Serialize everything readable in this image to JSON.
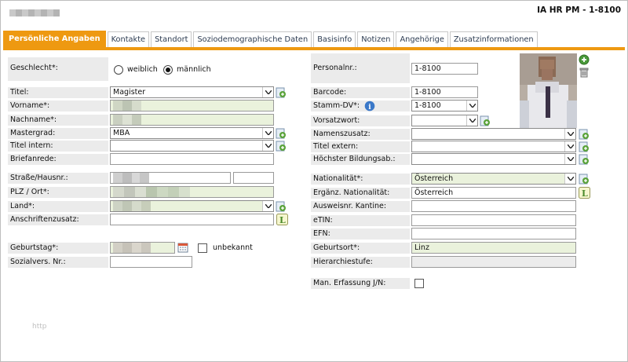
{
  "header": {
    "app_title": "IA HR PM - 1-8100"
  },
  "tabs": [
    "Persönliche Angaben",
    "Kontakte",
    "Standort",
    "Soziodemographische Daten",
    "Basisinfo",
    "Notizen",
    "Angehörige",
    "Zusatzinformationen"
  ],
  "left": {
    "gender": {
      "label": "Geschlecht*:",
      "option_female": "weiblich",
      "option_male": "männlich",
      "selected": "männlich"
    },
    "title": {
      "label": "Titel:",
      "value": "Magister"
    },
    "first_name": {
      "label": "Vorname*:"
    },
    "last_name": {
      "label": "Nachname*:"
    },
    "master_degree": {
      "label": "Mastergrad:",
      "value": "MBA"
    },
    "title_internal": {
      "label": "Titel intern:",
      "value": ""
    },
    "salutation": {
      "label": "Briefanrede:",
      "value": ""
    },
    "street": {
      "label": "Straße/Hausnr.:"
    },
    "zip_city": {
      "label": "PLZ / Ort*:"
    },
    "country": {
      "label": "Land*:"
    },
    "address_extra": {
      "label": "Anschriftenzusatz:",
      "value": ""
    },
    "birthday": {
      "label": "Geburtstag*:",
      "unknown_label": "unbekannt"
    },
    "social_security": {
      "label": "Sozialvers. Nr.:",
      "value": ""
    }
  },
  "right": {
    "personnel_no": {
      "label": "Personalnr.:",
      "value": "1-8100"
    },
    "barcode": {
      "label": "Barcode:",
      "value": "1-8100"
    },
    "master_dv": {
      "label": "Stamm-DV*:",
      "value": "1-8100"
    },
    "prefix": {
      "label": "Vorsatzwort:",
      "value": ""
    },
    "name_suffix": {
      "label": "Namenszusatz:",
      "value": ""
    },
    "title_external": {
      "label": "Titel extern:",
      "value": ""
    },
    "highest_education": {
      "label": "Höchster Bildungsab.:",
      "value": ""
    },
    "nationality": {
      "label": "Nationalität*:",
      "value": "Österreich"
    },
    "add_nationality": {
      "label": "Ergänz. Nationalität:",
      "value": "Österreich"
    },
    "canteen_card": {
      "label": "Ausweisnr. Kantine:",
      "value": ""
    },
    "etin": {
      "label": "eTIN:",
      "value": ""
    },
    "efn": {
      "label": "EFN:",
      "value": ""
    },
    "birthplace": {
      "label": "Geburtsort*:",
      "value": "Linz"
    },
    "hierarchy": {
      "label": "Hierarchiestufe:",
      "value": ""
    },
    "manual_entry": {
      "label": "Man. Erfassung J/N:"
    }
  },
  "footer": {
    "text": "http"
  },
  "colors": {
    "accent": "#ee9911",
    "label_bg": "#ebebeb",
    "mandatory_bg": "#eaf2dc",
    "tab_text": "#2d3c52"
  }
}
